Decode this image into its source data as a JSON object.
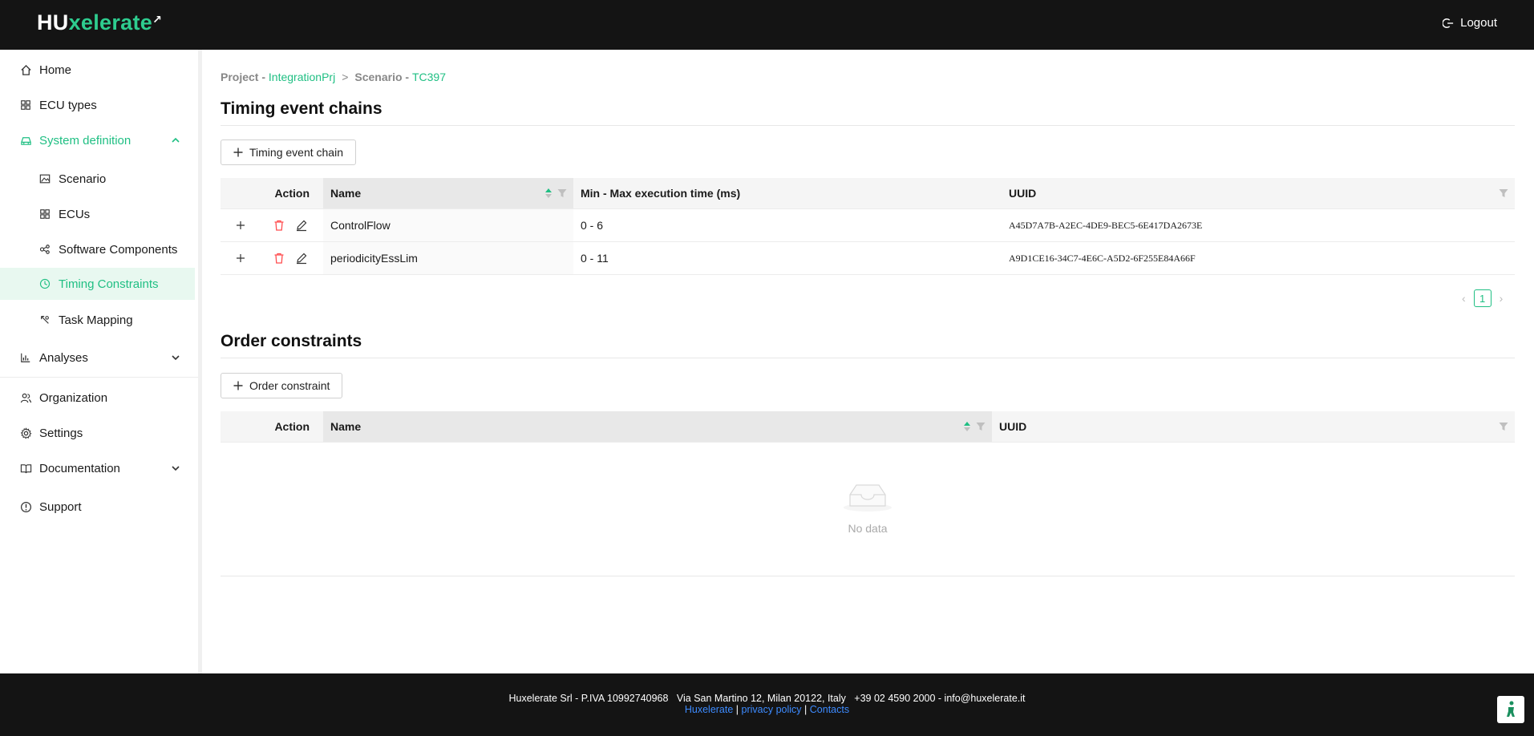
{
  "header": {
    "logo_part1": "HU",
    "logo_part2": "xelerate",
    "logout_label": "Logout"
  },
  "sidebar": {
    "items": [
      {
        "label": "Home",
        "icon": "home-icon"
      },
      {
        "label": "ECU types",
        "icon": "grid-icon"
      },
      {
        "label": "System definition",
        "icon": "car-icon"
      },
      {
        "label": "Scenario",
        "icon": "image-icon"
      },
      {
        "label": "ECUs",
        "icon": "grid-icon"
      },
      {
        "label": "Software Components",
        "icon": "nodes-icon"
      },
      {
        "label": "Timing Constraints",
        "icon": "clock-icon"
      },
      {
        "label": "Task Mapping",
        "icon": "mapping-icon"
      },
      {
        "label": "Analyses",
        "icon": "bar-chart-icon"
      },
      {
        "label": "Organization",
        "icon": "team-icon"
      },
      {
        "label": "Settings",
        "icon": "gear-icon"
      },
      {
        "label": "Documentation",
        "icon": "book-icon"
      },
      {
        "label": "Support",
        "icon": "info-icon"
      }
    ]
  },
  "breadcrumb": {
    "project_prefix": "Project - ",
    "project_name": "IntegrationPrj",
    "separator": ">",
    "scenario_prefix": "Scenario - ",
    "scenario_name": "TC397"
  },
  "timing": {
    "title": "Timing event chains",
    "add_button": "Timing event chain",
    "columns": [
      "Action",
      "Name",
      "Min - Max execution time (ms)",
      "UUID"
    ],
    "rows": [
      {
        "name": "ControlFlow",
        "time": "0 - 6",
        "uuid": "A45D7A7B-A2EC-4DE9-BEC5-6E417DA2673E"
      },
      {
        "name": "periodicityEssLim",
        "time": "0 - 11",
        "uuid": "A9D1CE16-34C7-4E6C-A5D2-6F255E84A66F"
      }
    ],
    "current_page": "1"
  },
  "order": {
    "title": "Order constraints",
    "add_button": "Order constraint",
    "columns": [
      "Action",
      "Name",
      "UUID"
    ],
    "empty_text": "No data"
  },
  "footer": {
    "line1": "Huxelerate Srl - P.IVA 10992740968   Via San Martino 12, Milan 20122, Italy   +39 02 4590 2000 - info@huxelerate.it",
    "link1": "Huxelerate",
    "link2": "privacy policy",
    "link3": "Contacts",
    "sep": "|"
  },
  "colors": {
    "accent": "#1fbf83",
    "header_bg": "#141414",
    "danger": "#ff4d4f"
  }
}
